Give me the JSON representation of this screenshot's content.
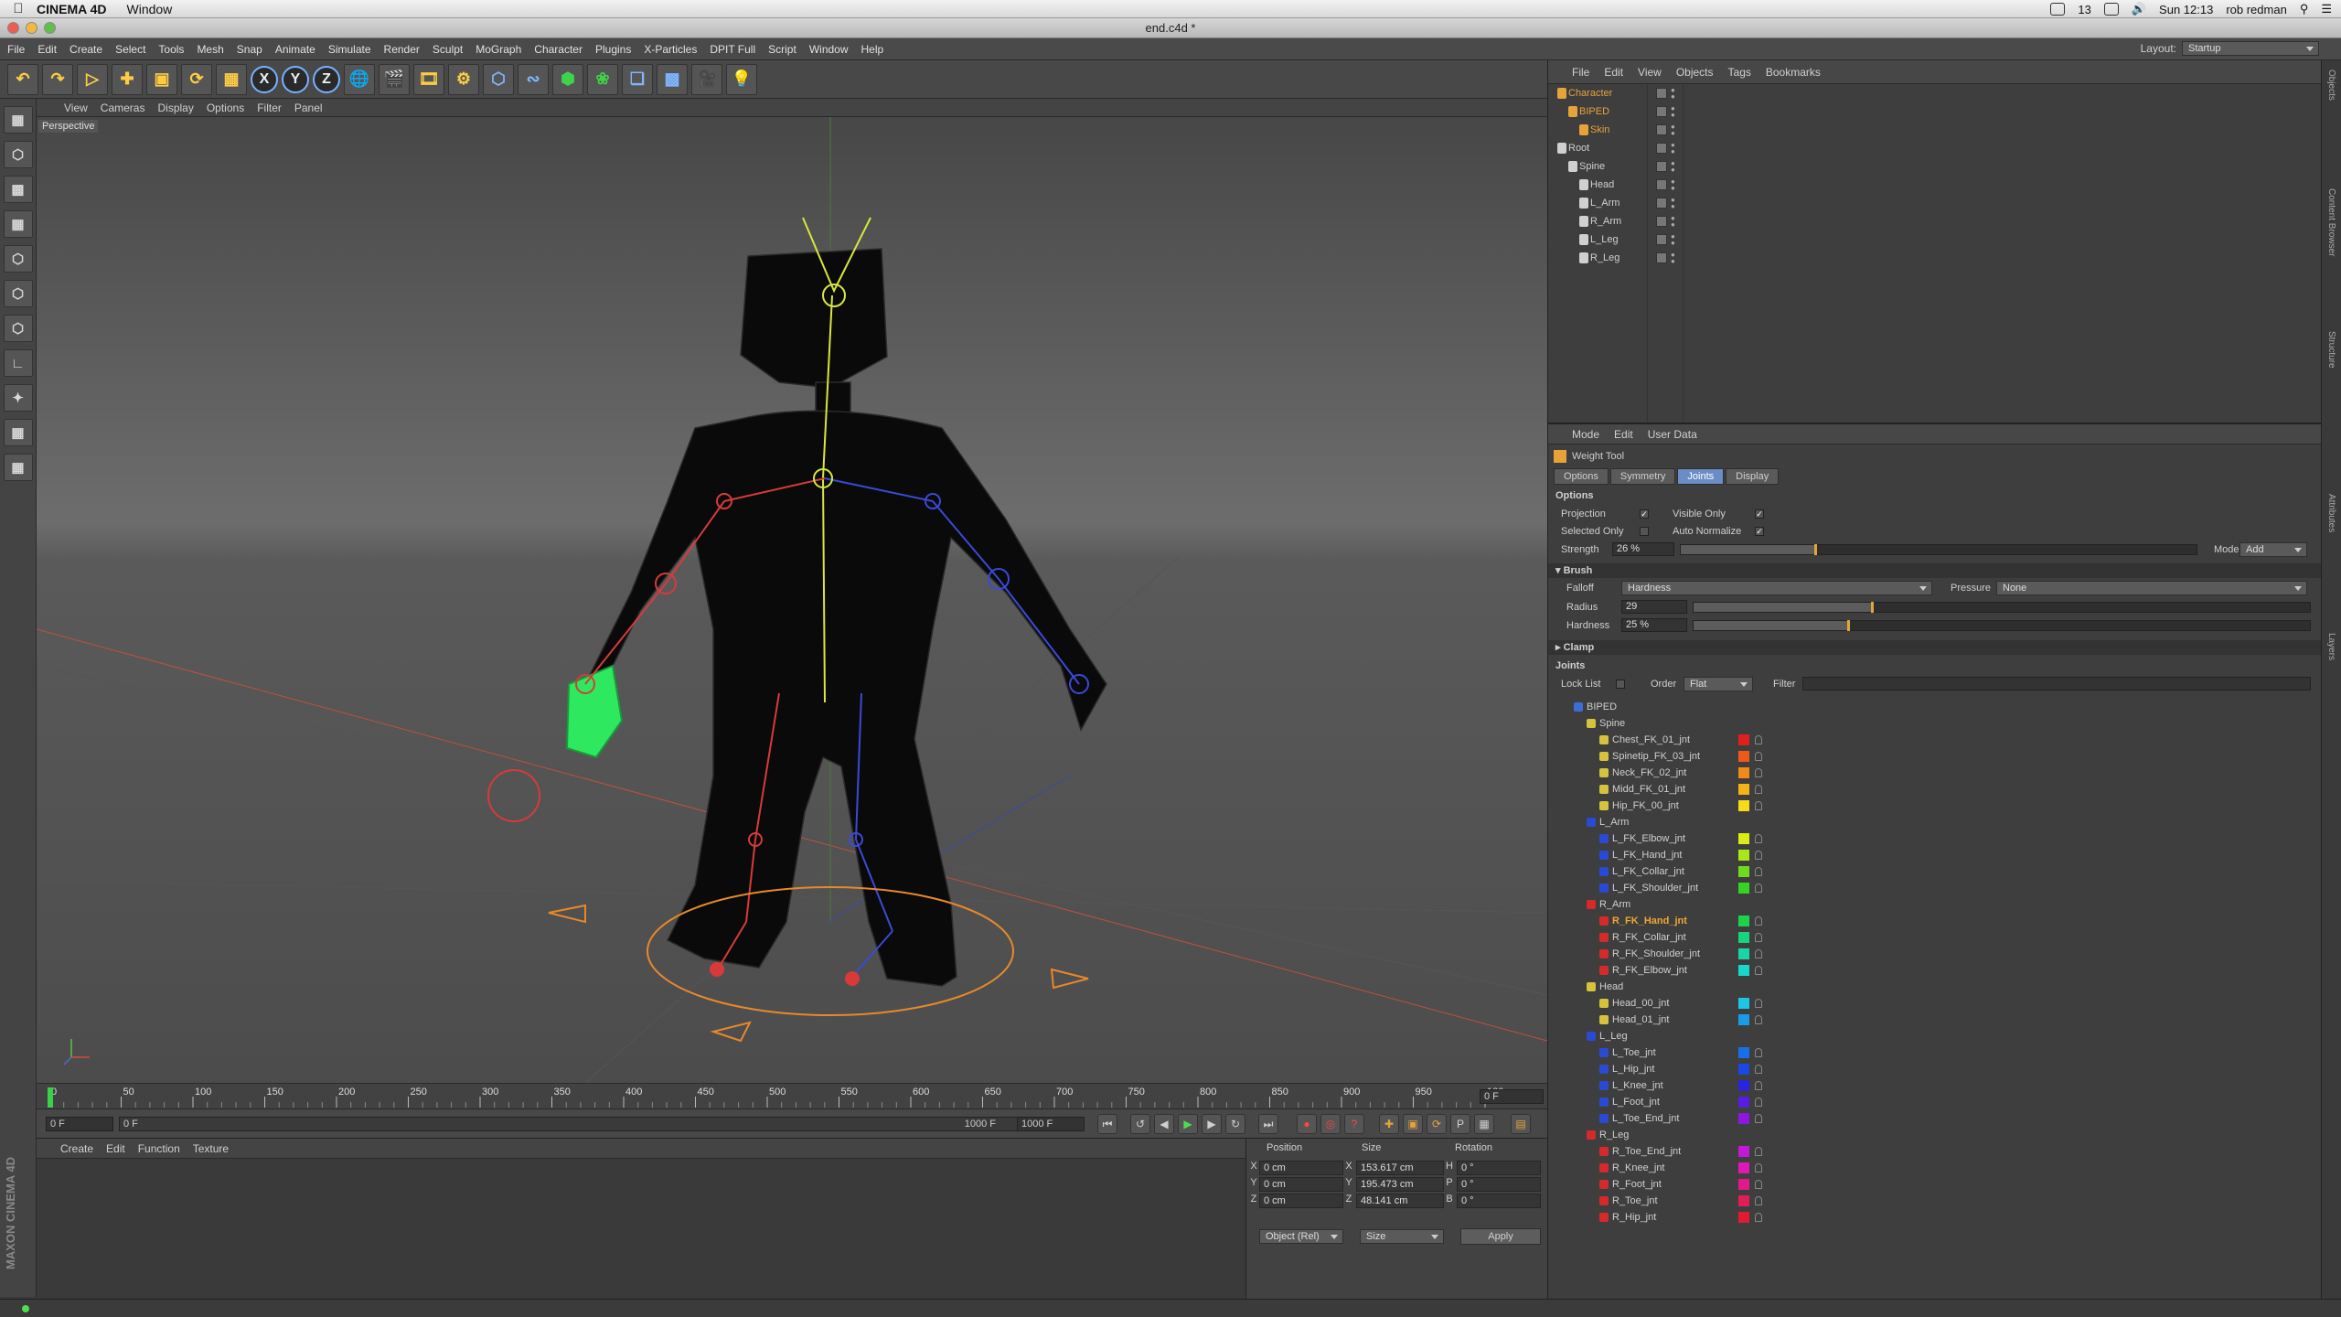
{
  "mac_menubar": {
    "app": "CINEMA 4D",
    "menu": "Window",
    "battery_level": "13",
    "clock": "Sun 12:13",
    "user": "rob redman"
  },
  "window": {
    "title": "end.c4d *"
  },
  "menu": [
    "File",
    "Edit",
    "Create",
    "Select",
    "Tools",
    "Mesh",
    "Snap",
    "Animate",
    "Simulate",
    "Render",
    "Sculpt",
    "MoGraph",
    "Character",
    "Plugins",
    "X-Particles",
    "DPIT Full",
    "Script",
    "Window",
    "Help"
  ],
  "layout": {
    "label": "Layout:",
    "value": "Startup"
  },
  "toolbar": {
    "axis_x": "X",
    "axis_y": "Y",
    "axis_z": "Z"
  },
  "viewport": {
    "menu": [
      "View",
      "Cameras",
      "Display",
      "Options",
      "Filter",
      "Panel"
    ],
    "label": "Perspective"
  },
  "timeline": {
    "ticks": [
      "0",
      "50",
      "100",
      "150",
      "200",
      "250",
      "300",
      "350",
      "400",
      "450",
      "500",
      "550",
      "600",
      "650",
      "700",
      "750",
      "800",
      "850",
      "900",
      "950",
      "100"
    ],
    "current": "0 F"
  },
  "transport": {
    "start": "0 F",
    "range_start": "0 F",
    "range_end": "1000 F",
    "end": "1000 F"
  },
  "material_manager": {
    "menu": [
      "Create",
      "Edit",
      "Function",
      "Texture"
    ]
  },
  "coordinates": {
    "headers": [
      "Position",
      "Size",
      "Rotation"
    ],
    "rows": [
      {
        "axis": "X",
        "pos": "0 cm",
        "size": "153.617 cm",
        "rot_axis": "H",
        "rot": "0 °"
      },
      {
        "axis": "Y",
        "pos": "0 cm",
        "size": "195.473 cm",
        "rot_axis": "P",
        "rot": "0 °"
      },
      {
        "axis": "Z",
        "pos": "0 cm",
        "size": "48.141 cm",
        "rot_axis": "B",
        "rot": "0 °"
      }
    ],
    "mode": "Object (Rel)",
    "size_mode": "Size",
    "apply": "Apply"
  },
  "object_manager": {
    "menu": [
      "File",
      "Edit",
      "View",
      "Objects",
      "Tags",
      "Bookmarks"
    ],
    "objects": [
      {
        "name": "Character",
        "color": "#e8a23a"
      },
      {
        "name": "BIPED",
        "color": "#e8a23a"
      },
      {
        "name": "Skin",
        "color": "#e8a23a"
      },
      {
        "name": "Root",
        "color": "#d0d0d0"
      },
      {
        "name": "Spine",
        "color": "#d0d0d0"
      },
      {
        "name": "Head",
        "color": "#d0d0d0"
      },
      {
        "name": "L_Arm",
        "color": "#d0d0d0"
      },
      {
        "name": "R_Arm",
        "color": "#d0d0d0"
      },
      {
        "name": "L_Leg",
        "color": "#d0d0d0"
      },
      {
        "name": "R_Leg",
        "color": "#d0d0d0"
      }
    ]
  },
  "attributes": {
    "menu": [
      "Mode",
      "Edit",
      "User Data"
    ],
    "tool_name": "Weight Tool",
    "tabs": [
      "Options",
      "Symmetry",
      "Joints",
      "Display"
    ],
    "options_title": "Options",
    "projection": "Projection",
    "visible_only": "Visible Only",
    "selected_only": "Selected Only",
    "auto_normalize": "Auto Normalize",
    "strength_label": "Strength",
    "strength": "26 %",
    "strength_fraction": 0.26,
    "mode_label": "Mode",
    "mode": "Add",
    "brush_title": "Brush",
    "falloff_label": "Falloff",
    "falloff": "Hardness",
    "pressure_label": "Pressure",
    "pressure": "None",
    "radius_label": "Radius",
    "radius": "29",
    "radius_fraction": 0.29,
    "hardness_label": "Hardness",
    "hardness": "25 %",
    "hardness_fraction": 0.25,
    "clamp_title": "Clamp",
    "joints_title": "Joints",
    "lock_list": "Lock List",
    "order_label": "Order",
    "order": "Flat",
    "filter_label": "Filter"
  },
  "joints": [
    {
      "name": "BIPED",
      "level": 0,
      "group": true,
      "icon": "#3b6fd6"
    },
    {
      "name": "Spine",
      "level": 1,
      "group": true,
      "icon": "#d6c23b"
    },
    {
      "name": "Chest_FK_01_jnt",
      "level": 2,
      "swatch": "#e0201c",
      "icon": "#d6c23b"
    },
    {
      "name": "Spinetip_FK_03_jnt",
      "level": 2,
      "swatch": "#ee5a1a",
      "icon": "#d6c23b"
    },
    {
      "name": "Neck_FK_02_jnt",
      "level": 2,
      "swatch": "#f08a18",
      "icon": "#d6c23b"
    },
    {
      "name": "Midd_FK_01_jnt",
      "level": 2,
      "swatch": "#f5b316",
      "icon": "#d6c23b"
    },
    {
      "name": "Hip_FK_00_jnt",
      "level": 2,
      "swatch": "#f5dc16",
      "icon": "#d6c23b"
    },
    {
      "name": "L_Arm",
      "level": 1,
      "group": true,
      "icon": "#2a4ad6"
    },
    {
      "name": "L_FK_Elbow_jnt",
      "level": 2,
      "swatch": "#d8ee16",
      "icon": "#2a4ad6"
    },
    {
      "name": "L_FK_Hand_jnt",
      "level": 2,
      "swatch": "#a8e818",
      "icon": "#2a4ad6"
    },
    {
      "name": "L_FK_Collar_jnt",
      "level": 2,
      "swatch": "#6edc1c",
      "icon": "#2a4ad6"
    },
    {
      "name": "L_FK_Shoulder_jnt",
      "level": 2,
      "swatch": "#34d424",
      "icon": "#2a4ad6"
    },
    {
      "name": "R_Arm",
      "level": 1,
      "group": true,
      "icon": "#d62a2a"
    },
    {
      "name": "R_FK_Hand_jnt",
      "level": 2,
      "swatch": "#1ed24a",
      "icon": "#d62a2a",
      "selected": true
    },
    {
      "name": "R_FK_Collar_jnt",
      "level": 2,
      "swatch": "#18d47a",
      "icon": "#d62a2a"
    },
    {
      "name": "R_FK_Shoulder_jnt",
      "level": 2,
      "swatch": "#18d6a8",
      "icon": "#d62a2a"
    },
    {
      "name": "R_FK_Elbow_jnt",
      "level": 2,
      "swatch": "#18d8cc",
      "icon": "#d62a2a"
    },
    {
      "name": "Head",
      "level": 1,
      "group": true,
      "icon": "#d6c23b"
    },
    {
      "name": "Head_00_jnt",
      "level": 2,
      "swatch": "#18c8e6",
      "icon": "#d6c23b"
    },
    {
      "name": "Head_01_jnt",
      "level": 2,
      "swatch": "#189ce8",
      "icon": "#d6c23b"
    },
    {
      "name": "L_Leg",
      "level": 1,
      "group": true,
      "icon": "#2a4ad6"
    },
    {
      "name": "L_Toe_jnt",
      "level": 2,
      "swatch": "#1870e8",
      "icon": "#2a4ad6"
    },
    {
      "name": "L_Hip_jnt",
      "level": 2,
      "swatch": "#1a48e4",
      "icon": "#2a4ad6"
    },
    {
      "name": "L_Knee_jnt",
      "level": 2,
      "swatch": "#2a24e0",
      "icon": "#2a4ad6"
    },
    {
      "name": "L_Foot_jnt",
      "level": 2,
      "swatch": "#5a1ce0",
      "icon": "#2a4ad6"
    },
    {
      "name": "L_Toe_End_jnt",
      "level": 2,
      "swatch": "#8a18e0",
      "icon": "#2a4ad6"
    },
    {
      "name": "R_Leg",
      "level": 1,
      "group": true,
      "icon": "#d62a2a"
    },
    {
      "name": "R_Toe_End_jnt",
      "level": 2,
      "swatch": "#c418d8",
      "icon": "#d62a2a"
    },
    {
      "name": "R_Knee_jnt",
      "level": 2,
      "swatch": "#e018b8",
      "icon": "#d62a2a"
    },
    {
      "name": "R_Foot_jnt",
      "level": 2,
      "swatch": "#e4188a",
      "icon": "#d62a2a"
    },
    {
      "name": "R_Toe_jnt",
      "level": 2,
      "swatch": "#e41a5a",
      "icon": "#d62a2a"
    },
    {
      "name": "R_Hip_jnt",
      "level": 2,
      "swatch": "#e41a30",
      "icon": "#d62a2a"
    }
  ],
  "right_strip": [
    "Objects",
    "Content Browser",
    "Structure",
    "Attributes",
    "Layers"
  ],
  "branding": "MAXON CINEMA 4D"
}
